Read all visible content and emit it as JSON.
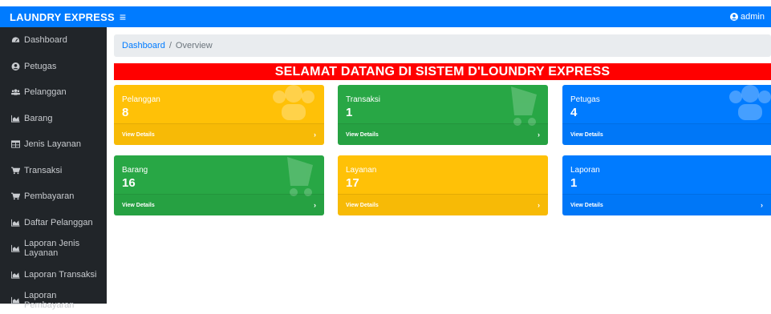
{
  "navbar": {
    "brand": "LAUNDRY EXPRESS",
    "menu_icon": "bars-icon",
    "user": "admin"
  },
  "sidebar": {
    "items": [
      {
        "label": "Dashboard",
        "icon": "dashboard-icon"
      },
      {
        "label": "Petugas",
        "icon": "user-circle-icon"
      },
      {
        "label": "Pelanggan",
        "icon": "users-icon"
      },
      {
        "label": "Barang",
        "icon": "chart-icon"
      },
      {
        "label": "Jenis Layanan",
        "icon": "table-icon"
      },
      {
        "label": "Transaksi",
        "icon": "cart-icon"
      },
      {
        "label": "Pembayaran",
        "icon": "cart-icon"
      },
      {
        "label": "Daftar Pelanggan",
        "icon": "chart-icon"
      },
      {
        "label": "Laporan Jenis Layanan",
        "icon": "chart-icon"
      },
      {
        "label": "Laporan Transaksi",
        "icon": "chart-icon"
      },
      {
        "label": "Laporan Pembayaran",
        "icon": "chart-icon"
      }
    ]
  },
  "breadcrumb": {
    "home": "Dashboard",
    "separator": "/",
    "current": "Overview"
  },
  "welcome": "SELAMAT DATANG DI SISTEM D'LOUNDRY EXPRESS",
  "cards": [
    {
      "label": "Pelanggan",
      "value": "8",
      "footer": "View Details",
      "color": "#ffc107",
      "icon": "users-icon"
    },
    {
      "label": "Transaksi",
      "value": "1",
      "footer": "View Details",
      "color": "#28a745",
      "icon": "cart-icon"
    },
    {
      "label": "Petugas",
      "value": "4",
      "footer": "View Details",
      "color": "#007bff",
      "icon": "users-icon"
    },
    {
      "label": "Barang",
      "value": "16",
      "footer": "View Details",
      "color": "#28a745",
      "icon": "cart-icon"
    },
    {
      "label": "Layanan",
      "value": "17",
      "footer": "View Details",
      "color": "#ffc107",
      "icon": ""
    },
    {
      "label": "Laporan",
      "value": "1",
      "footer": "View Details",
      "color": "#007bff",
      "icon": ""
    }
  ]
}
